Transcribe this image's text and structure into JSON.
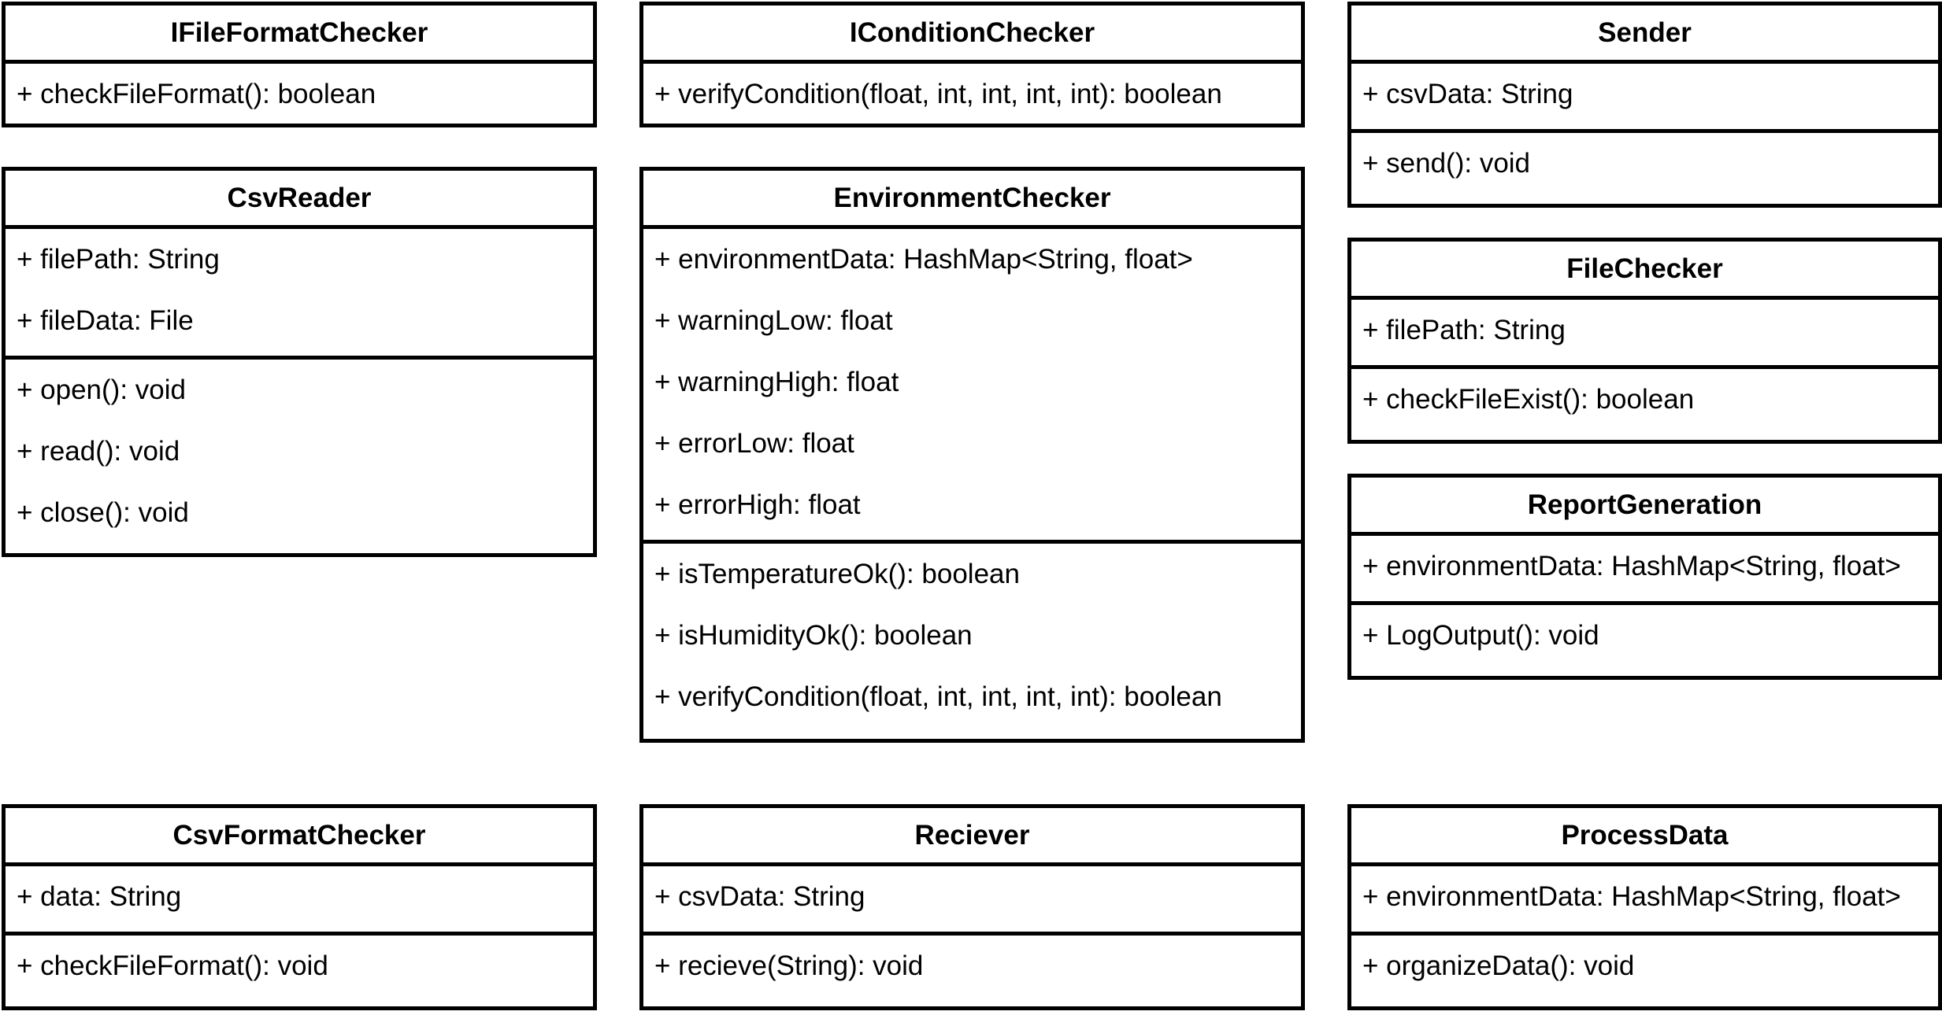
{
  "classes": [
    {
      "id": "ifileformatchecker",
      "name": "IFileFormatChecker",
      "attributes": [],
      "methods": [
        "+ checkFileFormat(): boolean"
      ]
    },
    {
      "id": "iconditionchecker",
      "name": "IConditionChecker",
      "attributes": [],
      "methods": [
        "+ verifyCondition(float, int, int, int, int): boolean"
      ]
    },
    {
      "id": "sender",
      "name": "Sender",
      "attributes": [
        "+ csvData: String"
      ],
      "methods": [
        "+ send(): void"
      ]
    },
    {
      "id": "csvreader",
      "name": "CsvReader",
      "attributes": [
        "+ filePath: String",
        "+ fileData: File"
      ],
      "methods": [
        "+ open(): void",
        "+ read(): void",
        "+ close(): void"
      ]
    },
    {
      "id": "environmentchecker",
      "name": "EnvironmentChecker",
      "attributes": [
        "+ environmentData: HashMap<String, float>",
        "+ warningLow: float",
        "+ warningHigh: float",
        "+ errorLow: float",
        "+ errorHigh: float"
      ],
      "methods": [
        "+ isTemperatureOk(): boolean",
        "+ isHumidityOk(): boolean",
        "+ verifyCondition(float, int, int, int, int): boolean"
      ]
    },
    {
      "id": "filechecker",
      "name": "FileChecker",
      "attributes": [
        "+ filePath: String"
      ],
      "methods": [
        "+ checkFileExist(): boolean"
      ]
    },
    {
      "id": "reportgeneration",
      "name": "ReportGeneration",
      "attributes": [
        "+ environmentData: HashMap<String, float>"
      ],
      "methods": [
        "+ LogOutput(): void"
      ]
    },
    {
      "id": "csvformatchecker",
      "name": "CsvFormatChecker",
      "attributes": [
        "+ data: String"
      ],
      "methods": [
        "+ checkFileFormat(): void"
      ]
    },
    {
      "id": "reciever",
      "name": "Reciever",
      "attributes": [
        "+ csvData: String"
      ],
      "methods": [
        "+ recieve(String): void"
      ]
    },
    {
      "id": "processdata",
      "name": "ProcessData",
      "attributes": [
        "+ environmentData: HashMap<String, float>"
      ],
      "methods": [
        "+ organizeData(): void"
      ]
    }
  ]
}
